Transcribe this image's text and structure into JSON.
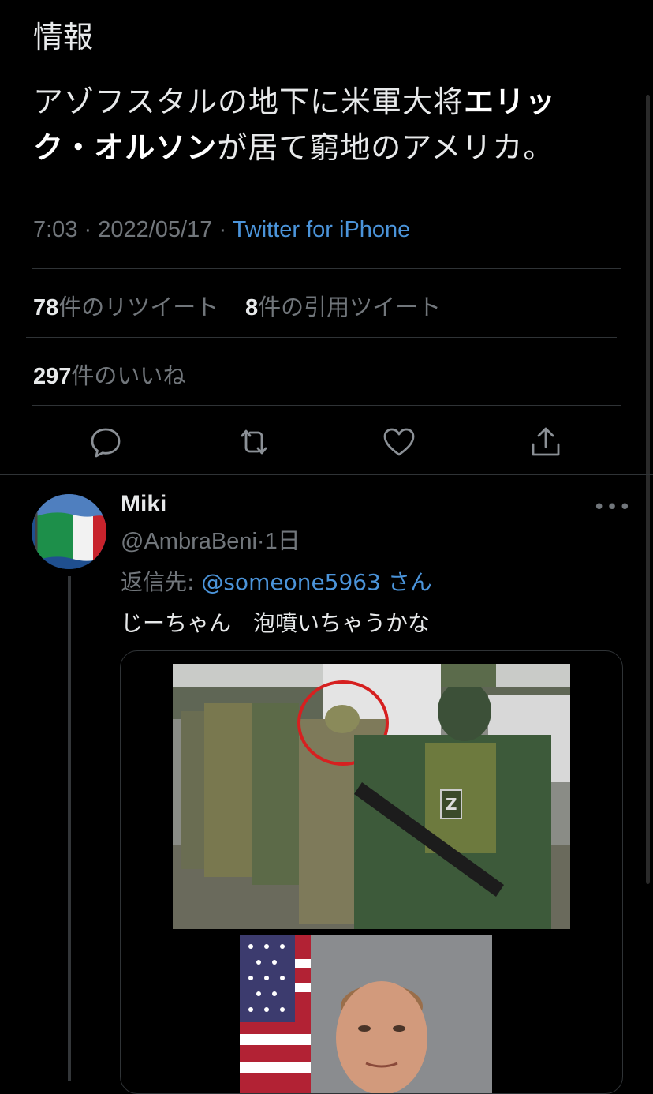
{
  "tweet": {
    "prefix": "情報",
    "text_part1": "アゾフスタルの地下に米軍大将",
    "text_bold": "エリック・オルソン",
    "text_part2": "が居て窮地のアメリカ。",
    "time": "7:03",
    "date": "2022/05/17",
    "source": "Twitter for iPhone",
    "retweets_count": "78",
    "retweets_label": "件のリツイート",
    "quotes_count": "8",
    "quotes_label": "件の引用ツイート",
    "likes_count": "297",
    "likes_label": "件のいいね"
  },
  "actions": {
    "reply_icon": "reply-icon",
    "retweet_icon": "retweet-icon",
    "like_icon": "heart-icon",
    "share_icon": "share-icon"
  },
  "reply": {
    "name": "Miki",
    "handle": "@AmbraBeni",
    "separator": "·",
    "age": "1日",
    "reply_to_label": "返信先:",
    "reply_to_handle": "@someone5963",
    "reply_to_suffix": "さん",
    "text": "じーちゃん　泡噴いちゃうかな",
    "more_icon": "more-icon"
  },
  "colors": {
    "background": "#000000",
    "text": "#e7e9ea",
    "muted": "#71767b",
    "link": "#4b94da",
    "divider": "#2f3336"
  }
}
